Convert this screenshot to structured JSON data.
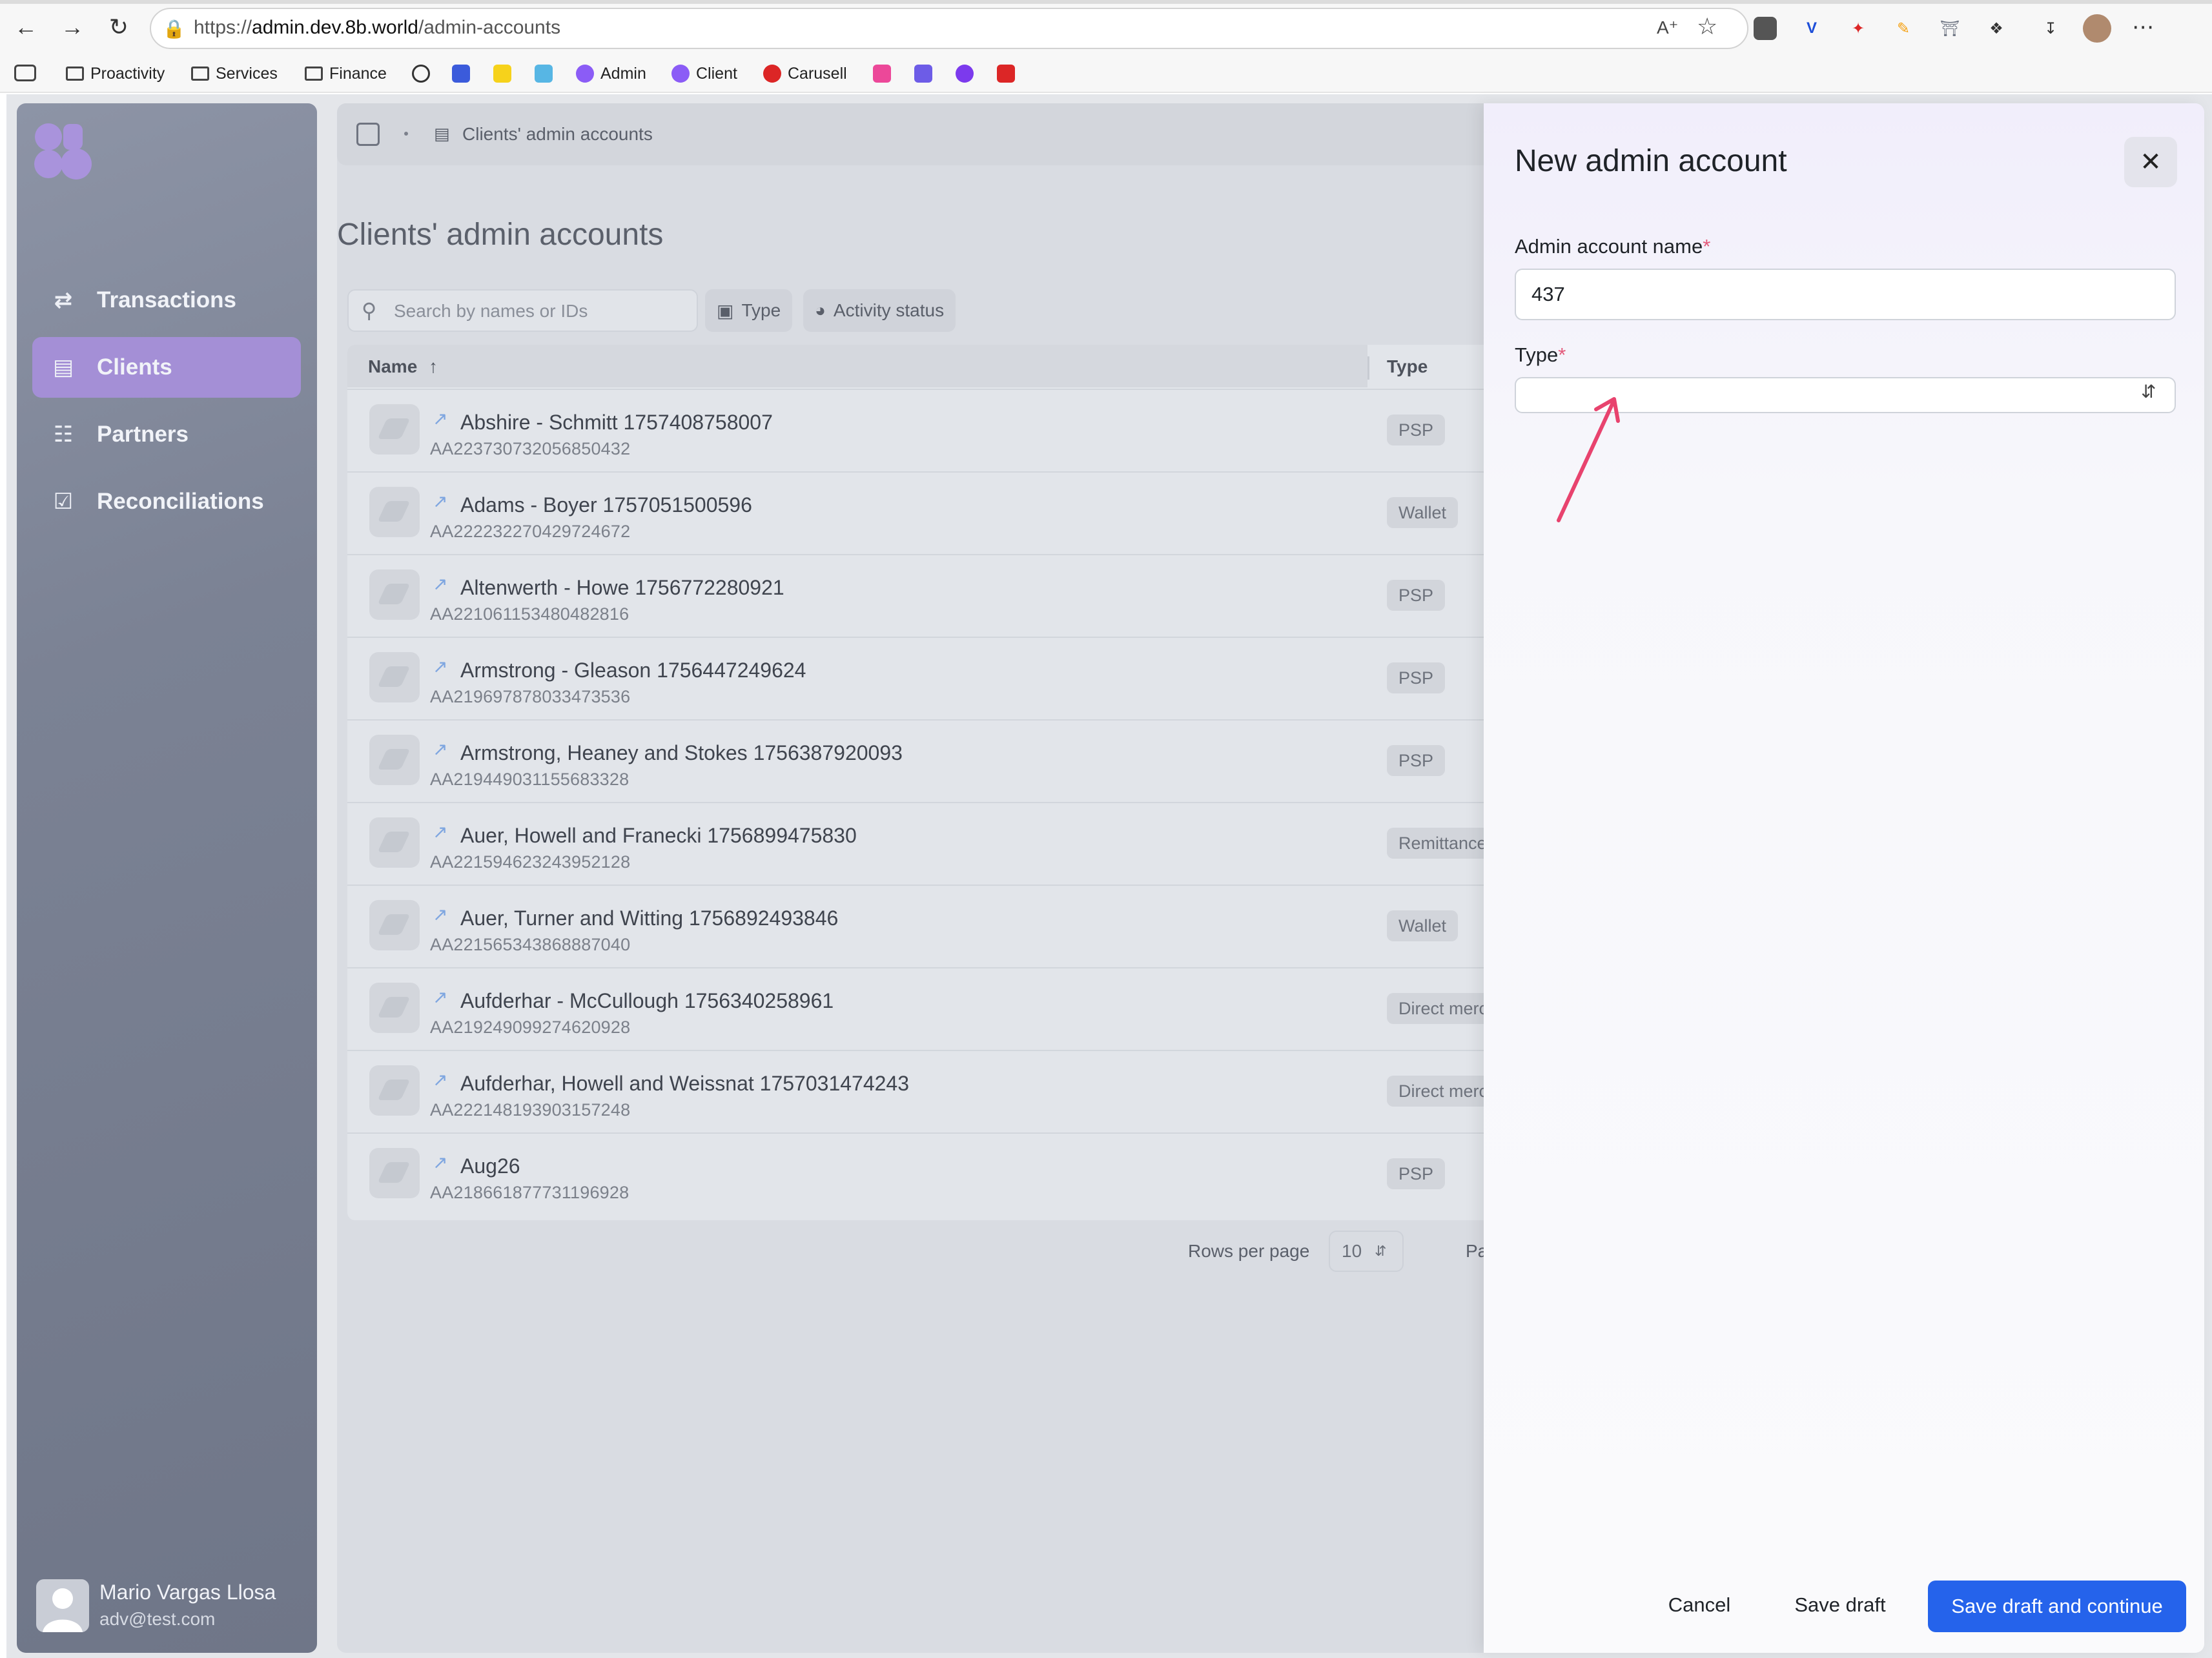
{
  "browser": {
    "url_prefix": "https://",
    "url_domain": "admin.dev.8b.world",
    "url_path": "/admin-accounts",
    "bookmarks": [
      {
        "label": "Proactivity",
        "icon": "folder-icon"
      },
      {
        "label": "Services",
        "icon": "folder-icon"
      },
      {
        "label": "Finance",
        "icon": "folder-icon"
      },
      {
        "label": "Admin",
        "icon": "8b-logo-icon"
      },
      {
        "label": "Client",
        "icon": "8b-logo-icon"
      },
      {
        "label": "Carusell",
        "icon": "carusell-icon"
      }
    ]
  },
  "sidebar": {
    "items": [
      {
        "label": "Transactions",
        "icon": "arrows-swap-icon",
        "active": false
      },
      {
        "label": "Clients",
        "icon": "server-icon",
        "active": true
      },
      {
        "label": "Partners",
        "icon": "network-icon",
        "active": false
      },
      {
        "label": "Reconciliations",
        "icon": "checklist-icon",
        "active": false
      }
    ],
    "user": {
      "name": "Mario Vargas Llosa",
      "email": "adv@test.com"
    }
  },
  "main": {
    "breadcrumb": "Clients' admin accounts",
    "title": "Clients' admin accounts",
    "search_placeholder": "Search by names or IDs",
    "filters": [
      "Type",
      "Activity status"
    ],
    "columns": {
      "name": "Name",
      "type": "Type"
    },
    "rows": [
      {
        "name": "Abshire - Schmitt 1757408758007",
        "id": "AA223730732056850432",
        "type": "PSP"
      },
      {
        "name": "Adams - Boyer 1757051500596",
        "id": "AA222232270429724672",
        "type": "Wallet"
      },
      {
        "name": "Altenwerth - Howe 1756772280921",
        "id": "AA221061153480482816",
        "type": "PSP"
      },
      {
        "name": "Armstrong - Gleason 1756447249624",
        "id": "AA219697878033473536",
        "type": "PSP"
      },
      {
        "name": "Armstrong, Heaney and Stokes 1756387920093",
        "id": "AA219449031155683328",
        "type": "PSP"
      },
      {
        "name": "Auer, Howell and Franecki 1756899475830",
        "id": "AA221594623243952128",
        "type": "Remittance"
      },
      {
        "name": "Auer, Turner and Witting 1756892493846",
        "id": "AA221565343868887040",
        "type": "Wallet"
      },
      {
        "name": "Aufderhar - McCullough 1756340258961",
        "id": "AA219249099274620928",
        "type": "Direct merchant"
      },
      {
        "name": "Aufderhar, Howell and Weissnat 1757031474243",
        "id": "AA222148193903157248",
        "type": "Direct merchant"
      },
      {
        "name": "Aug26",
        "id": "AA218661877731196928",
        "type": "PSP"
      }
    ],
    "pagination": {
      "rows_per_page_label": "Rows per page",
      "rows_per_page": "10",
      "page_label": "Pa"
    }
  },
  "drawer": {
    "title": "New admin account",
    "name_label": "Admin account name",
    "name_value": "437",
    "type_label": "Type",
    "required_mark": "*",
    "type_value": "",
    "buttons": {
      "cancel": "Cancel",
      "save_draft": "Save draft",
      "save_continue": "Save draft and continue"
    }
  },
  "colors": {
    "accent": "#2563eb",
    "active_nav": "#a48fd6",
    "annotation_arrow": "#e8436e"
  }
}
